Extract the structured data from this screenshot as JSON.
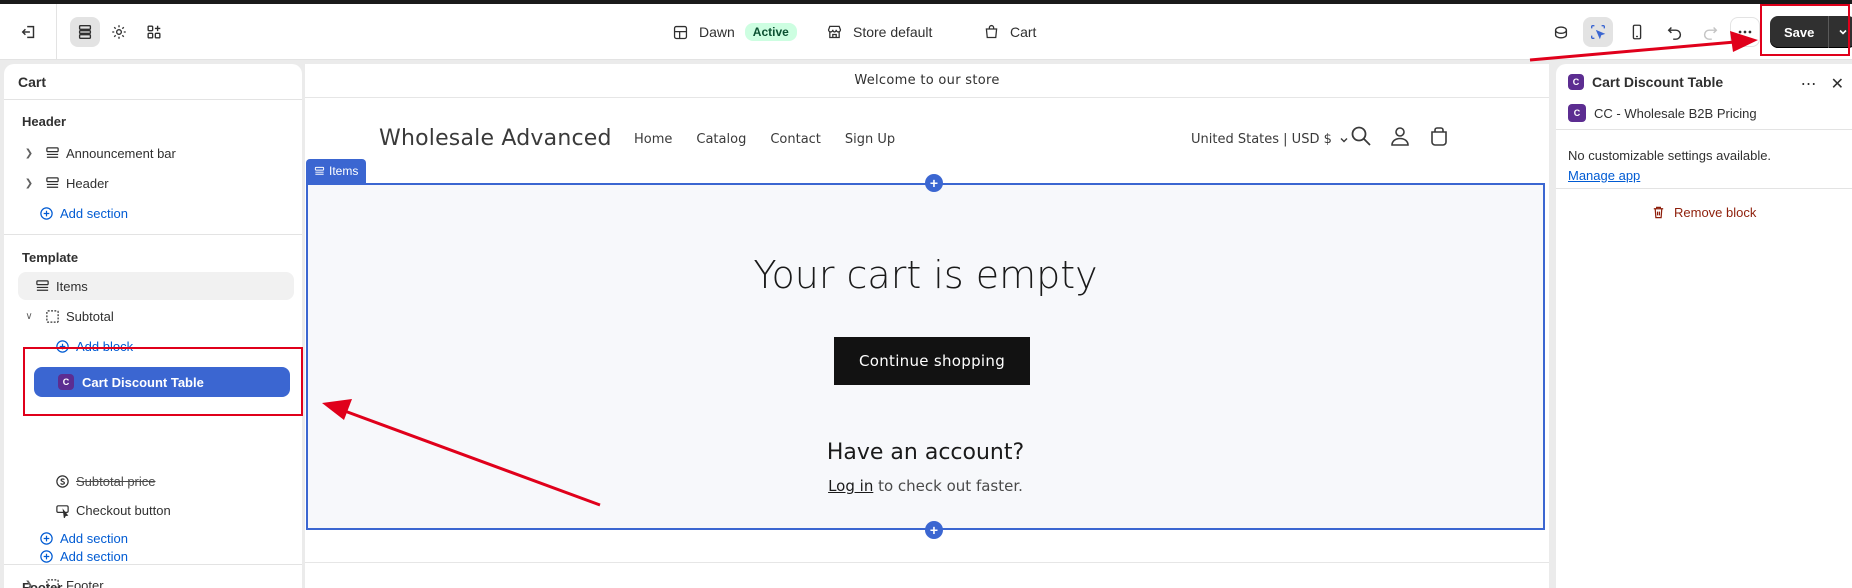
{
  "topbar": {
    "theme_name": "Dawn",
    "theme_status": "Active",
    "store_context": "Store default",
    "template": "Cart",
    "save_label": "Save"
  },
  "left_panel": {
    "title": "Cart",
    "header_group": {
      "title": "Header",
      "items": [
        {
          "label": "Announcement bar",
          "icon": "section-icon"
        },
        {
          "label": "Header",
          "icon": "section-icon"
        }
      ],
      "add_label": "Add section"
    },
    "template_group": {
      "title": "Template",
      "items_label": "Items",
      "subtotal_label": "Subtotal",
      "add_block_label": "Add block",
      "selected_block_label": "Cart Discount Table",
      "subtotal_price_label": "Subtotal price",
      "checkout_label": "Checkout button",
      "add_label": "Add section"
    },
    "footer_group": {
      "title": "Footer",
      "add_label": "Add section",
      "footer_label": "Footer"
    }
  },
  "preview": {
    "announcement": "Welcome to our store",
    "store_name": "Wholesale Advanced",
    "nav": [
      "Home",
      "Catalog",
      "Contact",
      "Sign Up"
    ],
    "currency": "United States | USD $",
    "items_tag": "Items",
    "empty_title": "Your cart is empty",
    "continue_label": "Continue shopping",
    "account_title": "Have an account?",
    "login_link": "Log in",
    "login_suffix": " to check out faster."
  },
  "right_panel": {
    "title": "Cart Discount Table",
    "app_name": "CC - Wholesale B2B Pricing",
    "no_settings": "No customizable settings available.",
    "manage_link": "Manage app",
    "remove_label": "Remove block"
  },
  "colors": {
    "accent_blue": "#3b66d1",
    "annotation_red": "#e0001b",
    "active_badge_bg": "#cdfee1"
  }
}
